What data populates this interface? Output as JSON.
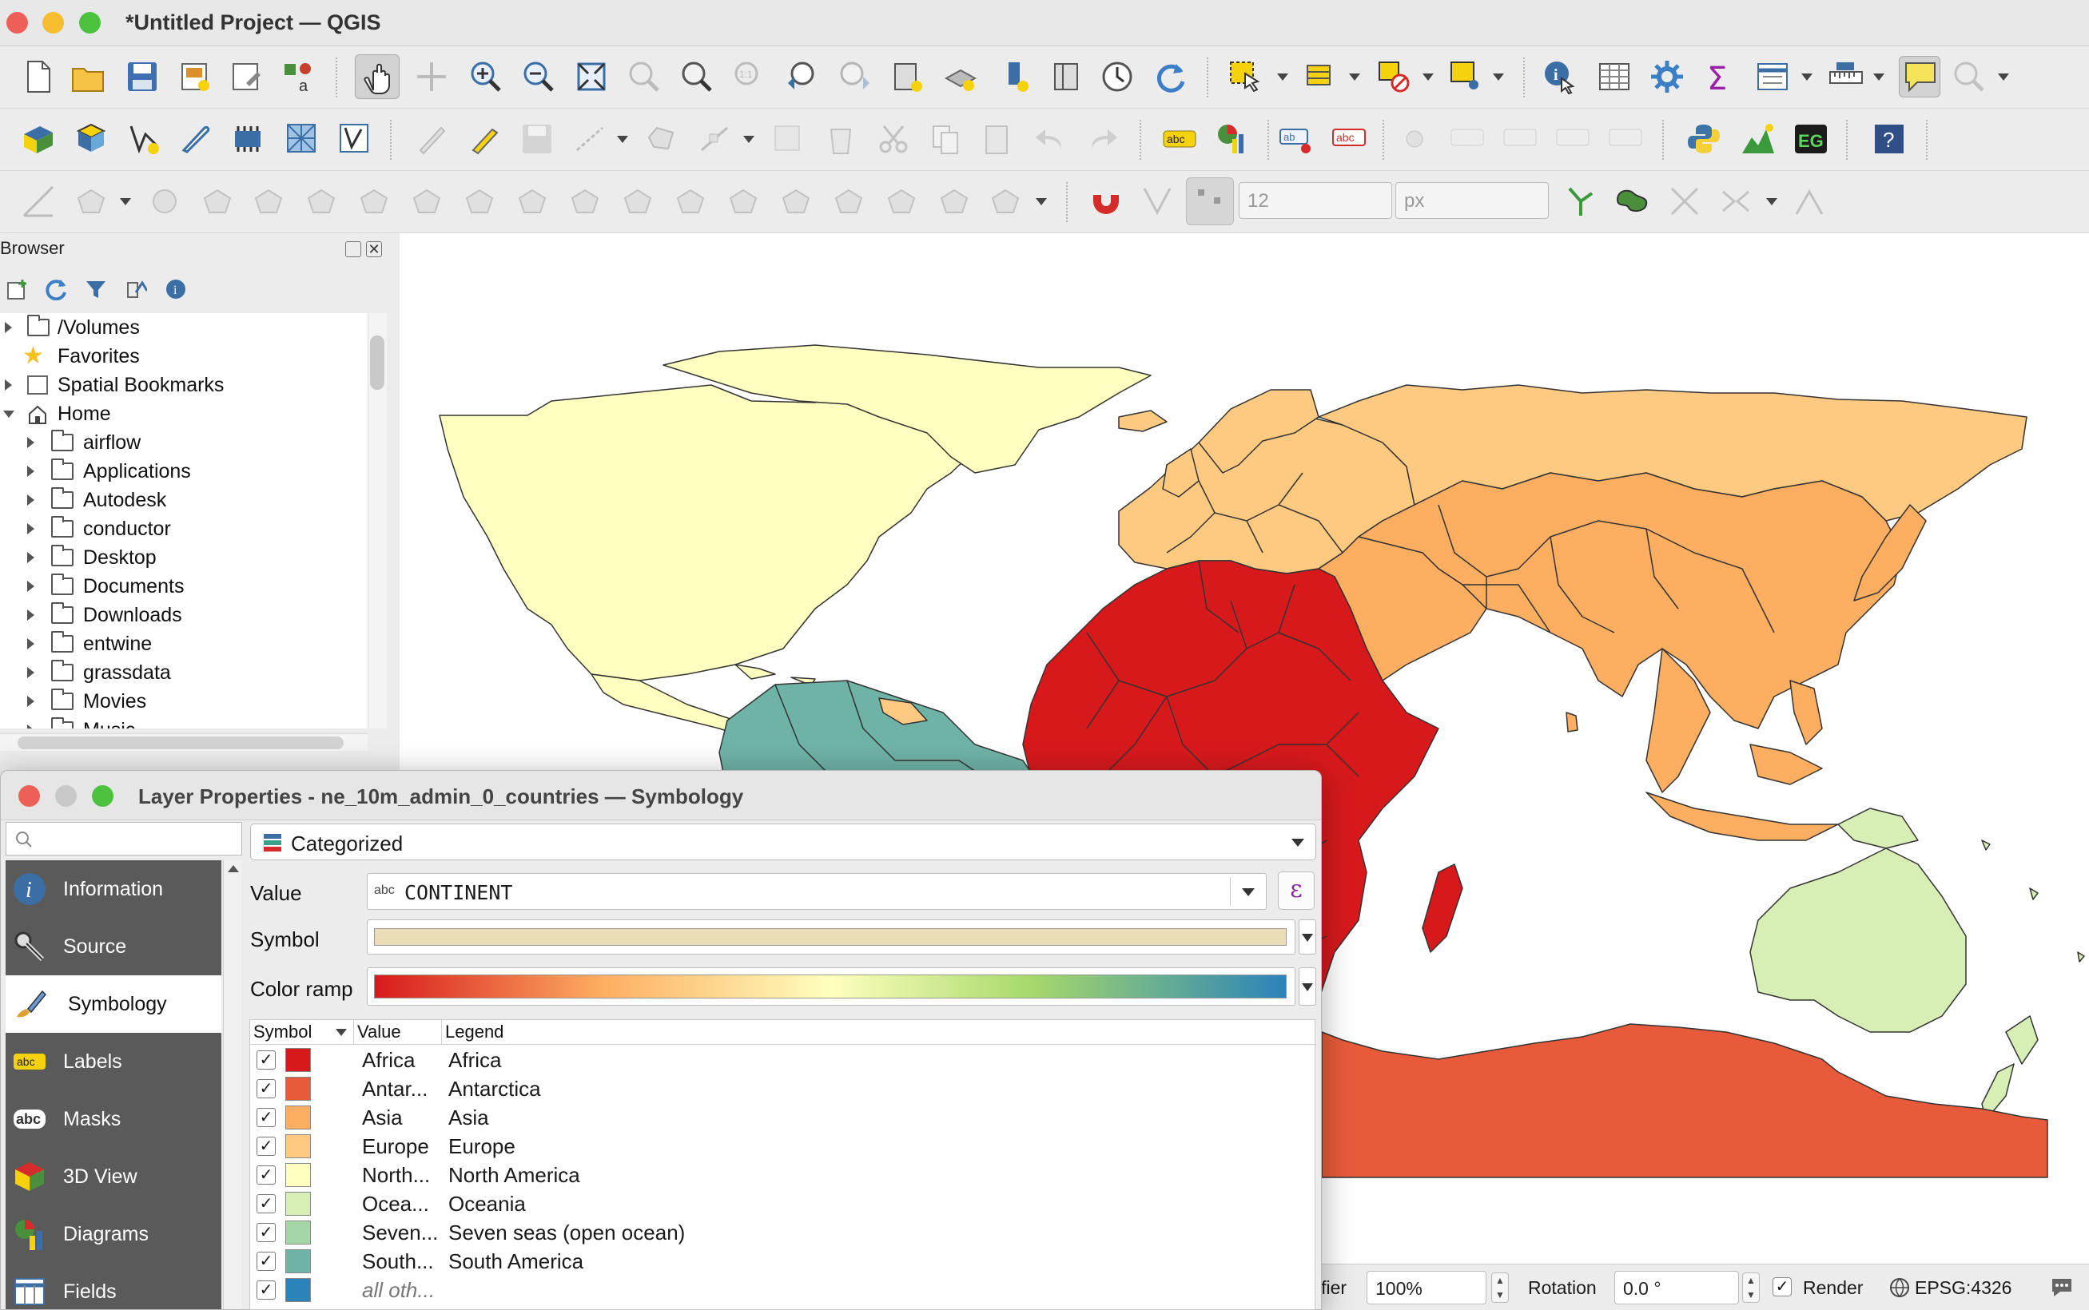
{
  "window": {
    "title": "*Untitled Project — QGIS"
  },
  "toolbar": {
    "font_size_value": "12",
    "unit_value": "px"
  },
  "browser": {
    "title": "Browser",
    "items": [
      {
        "label": "/Volumes"
      },
      {
        "label": "Favorites"
      },
      {
        "label": "Spatial Bookmarks"
      },
      {
        "label": "Home"
      },
      {
        "label": "airflow"
      },
      {
        "label": "Applications"
      },
      {
        "label": "Autodesk"
      },
      {
        "label": "conductor"
      },
      {
        "label": "Desktop"
      },
      {
        "label": "Documents"
      },
      {
        "label": "Downloads"
      },
      {
        "label": "entwine"
      },
      {
        "label": "grassdata"
      },
      {
        "label": "Movies"
      },
      {
        "label": "Music"
      }
    ]
  },
  "map": {
    "colors": {
      "africa": "#d7191c",
      "antarctica": "#e85b3a",
      "asia": "#fdae61",
      "europe": "#fec980",
      "north_america": "#ffffbf",
      "oceania": "#d7eeb5",
      "seven_seas": "#a5d6a8",
      "south_america": "#6fb2a6",
      "other": "#2b83ba"
    }
  },
  "statusbar": {
    "magnifier_label": "ifier",
    "magnifier_value": "100%",
    "rotation_label": "Rotation",
    "rotation_value": "0.0 °",
    "render_label": "Render",
    "crs": "EPSG:4326"
  },
  "dialog": {
    "title": "Layer Properties - ne_10m_admin_0_countries — Symbology",
    "renderer": "Categorized",
    "value_label": "Value",
    "value_type": "abc",
    "value_field": "CONTINENT",
    "symbol_label": "Symbol",
    "color_ramp_label": "Color ramp",
    "sidebar": [
      {
        "label": "Information",
        "icon": "info-icon"
      },
      {
        "label": "Source",
        "icon": "wrench-icon"
      },
      {
        "label": "Symbology",
        "icon": "paintbrush-icon"
      },
      {
        "label": "Labels",
        "icon": "labels-icon"
      },
      {
        "label": "Masks",
        "icon": "masks-icon"
      },
      {
        "label": "3D View",
        "icon": "cube-icon"
      },
      {
        "label": "Diagrams",
        "icon": "diagram-icon"
      },
      {
        "label": "Fields",
        "icon": "fields-icon"
      }
    ],
    "table": {
      "headers": {
        "symbol": "Symbol",
        "value": "Value",
        "legend": "Legend"
      },
      "rows": [
        {
          "value": "Africa",
          "legend": "Africa",
          "color": "#d7191c"
        },
        {
          "value": "Antar...",
          "legend": "Antarctica",
          "color": "#e85b3a"
        },
        {
          "value": "Asia",
          "legend": "Asia",
          "color": "#fdae61"
        },
        {
          "value": "Europe",
          "legend": "Europe",
          "color": "#fec980"
        },
        {
          "value": "North...",
          "legend": "North America",
          "color": "#ffffbf"
        },
        {
          "value": "Ocea...",
          "legend": "Oceania",
          "color": "#d7eeb5"
        },
        {
          "value": "Seven...",
          "legend": "Seven seas (open ocean)",
          "color": "#a5d6a8"
        },
        {
          "value": "South...",
          "legend": "South America",
          "color": "#6fb2a6"
        },
        {
          "value": "all oth...",
          "legend": "",
          "color": "#2b83ba"
        }
      ]
    }
  }
}
